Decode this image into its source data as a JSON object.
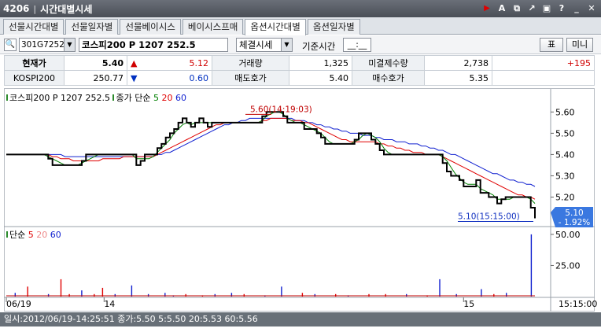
{
  "window": {
    "code": "4206",
    "title": "시간대별시세",
    "icons": [
      "play-icon",
      "font-icon",
      "export-icon",
      "link-icon",
      "copy-icon",
      "help-icon",
      "minimize-icon",
      "close-icon"
    ]
  },
  "tabs": [
    {
      "label": "선물시간대별",
      "active": false
    },
    {
      "label": "선물일자별",
      "active": false
    },
    {
      "label": "선물베이시스",
      "active": false
    },
    {
      "label": "베이시스프매",
      "active": false
    },
    {
      "label": "옵션시간대별",
      "active": true
    },
    {
      "label": "옵션일자별",
      "active": false
    }
  ],
  "controls": {
    "code_value": "301G7252",
    "name_value": "코스피200 P 1207 252.5",
    "select_value": "체결시세",
    "base_time_label": "기준시간",
    "base_time_value": "__:__",
    "btn_table": "표",
    "btn_mini": "미니"
  },
  "quote": {
    "r1": {
      "l1": "현재가",
      "v1": "5.40",
      "ch_sym": "▲",
      "ch": "5.12",
      "l2": "거래량",
      "v2": "1,325",
      "l3": "미결제수량",
      "v3": "2,738",
      "v4": "+195"
    },
    "r2": {
      "l1": "KOSPI200",
      "v1": "250.77",
      "ch_sym": "▼",
      "ch": "0.60",
      "l2": "매도호가",
      "v2": "5.40",
      "l3": "매수호가",
      "v3": "5.35"
    }
  },
  "legend_price": {
    "name": "코스피200 P 1207 252.5",
    "close_label": "종가 단순",
    "ma1": "5",
    "ma2": "20",
    "ma3": "60"
  },
  "legend_volume": {
    "label": "단순",
    "ma1": "5",
    "ma2": "20",
    "ma3": "60"
  },
  "colors": {
    "price": "#000000",
    "ma5": "#008000",
    "ma20": "#e00000",
    "ma60": "#1020d0",
    "current_box": "#3a78e0"
  },
  "chart_data": [
    {
      "type": "line",
      "title": "",
      "yticks": [
        "5.60",
        "5.50",
        "5.40",
        "5.30",
        "5.20"
      ],
      "ylim": [
        5.065,
        5.69
      ],
      "y_right_current": {
        "value": "5.10",
        "change": "- 1.92%"
      },
      "annotations": [
        {
          "text": "5.60(14:19:03)",
          "value": 5.6
        },
        {
          "text": "5.10(15:15:00)",
          "value": 5.1
        }
      ],
      "series": [
        {
          "role": "price",
          "values": [
            5.4,
            5.4,
            5.4,
            5.4,
            5.4,
            5.4,
            5.4,
            5.4,
            5.4,
            5.4,
            5.38,
            5.35,
            5.35,
            5.35,
            5.35,
            5.35,
            5.35,
            5.35,
            5.37,
            5.4,
            5.4,
            5.4,
            5.4,
            5.4,
            5.4,
            5.4,
            5.4,
            5.4,
            5.4,
            5.4,
            5.4,
            5.35,
            5.37,
            5.4,
            5.4,
            5.4,
            5.43,
            5.45,
            5.48,
            5.5,
            5.52,
            5.55,
            5.57,
            5.55,
            5.53,
            5.55,
            5.57,
            5.55,
            5.53,
            5.55,
            5.55,
            5.55,
            5.55,
            5.55,
            5.55,
            5.55,
            5.55,
            5.55,
            5.55,
            5.55,
            5.55,
            5.58,
            5.6,
            5.6,
            5.6,
            5.6,
            5.58,
            5.55,
            5.55,
            5.55,
            5.55,
            5.52,
            5.52,
            5.52,
            5.5,
            5.48,
            5.45,
            5.45,
            5.45,
            5.45,
            5.45,
            5.45,
            5.45,
            5.47,
            5.5,
            5.5,
            5.5,
            5.47,
            5.45,
            5.42,
            5.4,
            5.4,
            5.4,
            5.4,
            5.4,
            5.4,
            5.4,
            5.4,
            5.4,
            5.4,
            5.4,
            5.4,
            5.4,
            5.4,
            5.36,
            5.32,
            5.3,
            5.3,
            5.28,
            5.25,
            5.25,
            5.25,
            5.28,
            5.22,
            5.22,
            5.2,
            5.2,
            5.17,
            5.19,
            5.2,
            5.2,
            5.2,
            5.2,
            5.2,
            5.2,
            5.15,
            5.1
          ]
        },
        {
          "role": "ma5",
          "values": [
            5.4,
            5.4,
            5.4,
            5.4,
            5.4,
            5.4,
            5.4,
            5.4,
            5.4,
            5.4,
            5.39,
            5.38,
            5.37,
            5.36,
            5.35,
            5.35,
            5.35,
            5.35,
            5.36,
            5.37,
            5.38,
            5.39,
            5.4,
            5.4,
            5.4,
            5.4,
            5.4,
            5.4,
            5.4,
            5.4,
            5.4,
            5.38,
            5.38,
            5.38,
            5.38,
            5.39,
            5.41,
            5.43,
            5.45,
            5.47,
            5.5,
            5.52,
            5.54,
            5.55,
            5.54,
            5.55,
            5.55,
            5.55,
            5.55,
            5.55,
            5.55,
            5.55,
            5.55,
            5.55,
            5.55,
            5.55,
            5.55,
            5.55,
            5.55,
            5.55,
            5.55,
            5.56,
            5.58,
            5.59,
            5.6,
            5.6,
            5.59,
            5.57,
            5.56,
            5.55,
            5.55,
            5.54,
            5.53,
            5.52,
            5.51,
            5.5,
            5.48,
            5.46,
            5.45,
            5.45,
            5.45,
            5.45,
            5.45,
            5.46,
            5.47,
            5.49,
            5.5,
            5.49,
            5.48,
            5.46,
            5.43,
            5.41,
            5.4,
            5.4,
            5.4,
            5.4,
            5.4,
            5.4,
            5.4,
            5.4,
            5.4,
            5.4,
            5.4,
            5.4,
            5.39,
            5.37,
            5.34,
            5.31,
            5.29,
            5.27,
            5.26,
            5.26,
            5.26,
            5.24,
            5.23,
            5.22,
            5.21,
            5.19,
            5.19,
            5.19,
            5.19,
            5.2,
            5.2,
            5.2,
            5.2,
            5.19,
            5.17
          ]
        },
        {
          "role": "ma20",
          "values": [
            5.4,
            5.4,
            5.4,
            5.4,
            5.4,
            5.4,
            5.4,
            5.4,
            5.4,
            5.4,
            5.4,
            5.39,
            5.39,
            5.38,
            5.38,
            5.38,
            5.37,
            5.37,
            5.37,
            5.37,
            5.37,
            5.37,
            5.37,
            5.38,
            5.38,
            5.38,
            5.38,
            5.38,
            5.39,
            5.39,
            5.39,
            5.39,
            5.39,
            5.39,
            5.39,
            5.39,
            5.4,
            5.41,
            5.42,
            5.43,
            5.44,
            5.45,
            5.46,
            5.47,
            5.48,
            5.49,
            5.5,
            5.51,
            5.52,
            5.53,
            5.54,
            5.54,
            5.55,
            5.55,
            5.55,
            5.55,
            5.55,
            5.55,
            5.55,
            5.55,
            5.55,
            5.56,
            5.56,
            5.57,
            5.57,
            5.57,
            5.57,
            5.57,
            5.56,
            5.56,
            5.56,
            5.55,
            5.55,
            5.54,
            5.53,
            5.52,
            5.51,
            5.5,
            5.49,
            5.48,
            5.47,
            5.47,
            5.46,
            5.46,
            5.46,
            5.46,
            5.46,
            5.46,
            5.46,
            5.45,
            5.45,
            5.44,
            5.44,
            5.43,
            5.43,
            5.42,
            5.42,
            5.41,
            5.41,
            5.41,
            5.4,
            5.4,
            5.4,
            5.4,
            5.39,
            5.38,
            5.37,
            5.36,
            5.35,
            5.34,
            5.33,
            5.32,
            5.31,
            5.3,
            5.29,
            5.28,
            5.27,
            5.26,
            5.25,
            5.24,
            5.23,
            5.22,
            5.21,
            5.21,
            5.2,
            5.2,
            5.19
          ]
        },
        {
          "role": "ma60",
          "values": [
            5.4,
            5.4,
            5.4,
            5.4,
            5.4,
            5.4,
            5.4,
            5.4,
            5.4,
            5.4,
            5.4,
            5.4,
            5.4,
            5.4,
            5.39,
            5.39,
            5.39,
            5.39,
            5.39,
            5.39,
            5.39,
            5.39,
            5.39,
            5.39,
            5.39,
            5.39,
            5.39,
            5.39,
            5.39,
            5.39,
            5.39,
            5.39,
            5.39,
            5.39,
            5.39,
            5.39,
            5.4,
            5.4,
            5.41,
            5.41,
            5.42,
            5.43,
            5.44,
            5.45,
            5.46,
            5.47,
            5.48,
            5.49,
            5.5,
            5.51,
            5.52,
            5.53,
            5.54,
            5.54,
            5.55,
            5.55,
            5.56,
            5.56,
            5.57,
            5.57,
            5.57,
            5.57,
            5.57,
            5.57,
            5.57,
            5.57,
            5.57,
            5.57,
            5.57,
            5.56,
            5.56,
            5.56,
            5.55,
            5.55,
            5.54,
            5.54,
            5.53,
            5.53,
            5.52,
            5.52,
            5.51,
            5.51,
            5.5,
            5.5,
            5.5,
            5.49,
            5.49,
            5.49,
            5.48,
            5.48,
            5.47,
            5.47,
            5.47,
            5.46,
            5.46,
            5.46,
            5.45,
            5.45,
            5.45,
            5.44,
            5.44,
            5.43,
            5.43,
            5.42,
            5.42,
            5.41,
            5.4,
            5.4,
            5.39,
            5.38,
            5.37,
            5.36,
            5.35,
            5.34,
            5.33,
            5.32,
            5.31,
            5.31,
            5.3,
            5.29,
            5.28,
            5.28,
            5.27,
            5.27,
            5.26,
            5.26,
            5.25
          ]
        }
      ]
    },
    {
      "type": "bar",
      "title": "",
      "yticks": [
        "50.00",
        "25.00"
      ],
      "ylim": [
        0,
        55
      ],
      "values": [
        0,
        0,
        3,
        0,
        0,
        8,
        0,
        0,
        0,
        0,
        2,
        0,
        0,
        14,
        0,
        2,
        0,
        0,
        5,
        0,
        0,
        2,
        0,
        7,
        0,
        0,
        2,
        0,
        0,
        0,
        9,
        0,
        0,
        0,
        2,
        0,
        0,
        0,
        3,
        0,
        1,
        0,
        0,
        2,
        0,
        0,
        0,
        1,
        0,
        0,
        2,
        0,
        0,
        0,
        3,
        0,
        0,
        2,
        0,
        0,
        0,
        0,
        1,
        0,
        0,
        0,
        8,
        0,
        0,
        0,
        0,
        3,
        0,
        0,
        2,
        0,
        0,
        0,
        0,
        2,
        0,
        0,
        1,
        0,
        0,
        0,
        0,
        2,
        0,
        0,
        0,
        2,
        0,
        0,
        0,
        0,
        2,
        0,
        0,
        0,
        0,
        1,
        0,
        0,
        14,
        0,
        0,
        0,
        2,
        0,
        0,
        0,
        0,
        0,
        6,
        0,
        0,
        2,
        0,
        0,
        3,
        0,
        0,
        0,
        0,
        0,
        50,
        0
      ],
      "colors_cycle": [
        "#1020d0",
        "#e00000"
      ],
      "x_ticks": [
        {
          "label": "06/19",
          "pos": 0.0
        },
        {
          "label": "14",
          "pos": 0.185
        },
        {
          "label": "15",
          "pos": 0.865
        },
        {
          "label": "15:15:00",
          "pos": 1.0
        }
      ]
    }
  ],
  "status": {
    "text": "일시:2012/06/19-14:25:51 종가:5.50 5:5.50 20:5.53 60:5.56"
  }
}
